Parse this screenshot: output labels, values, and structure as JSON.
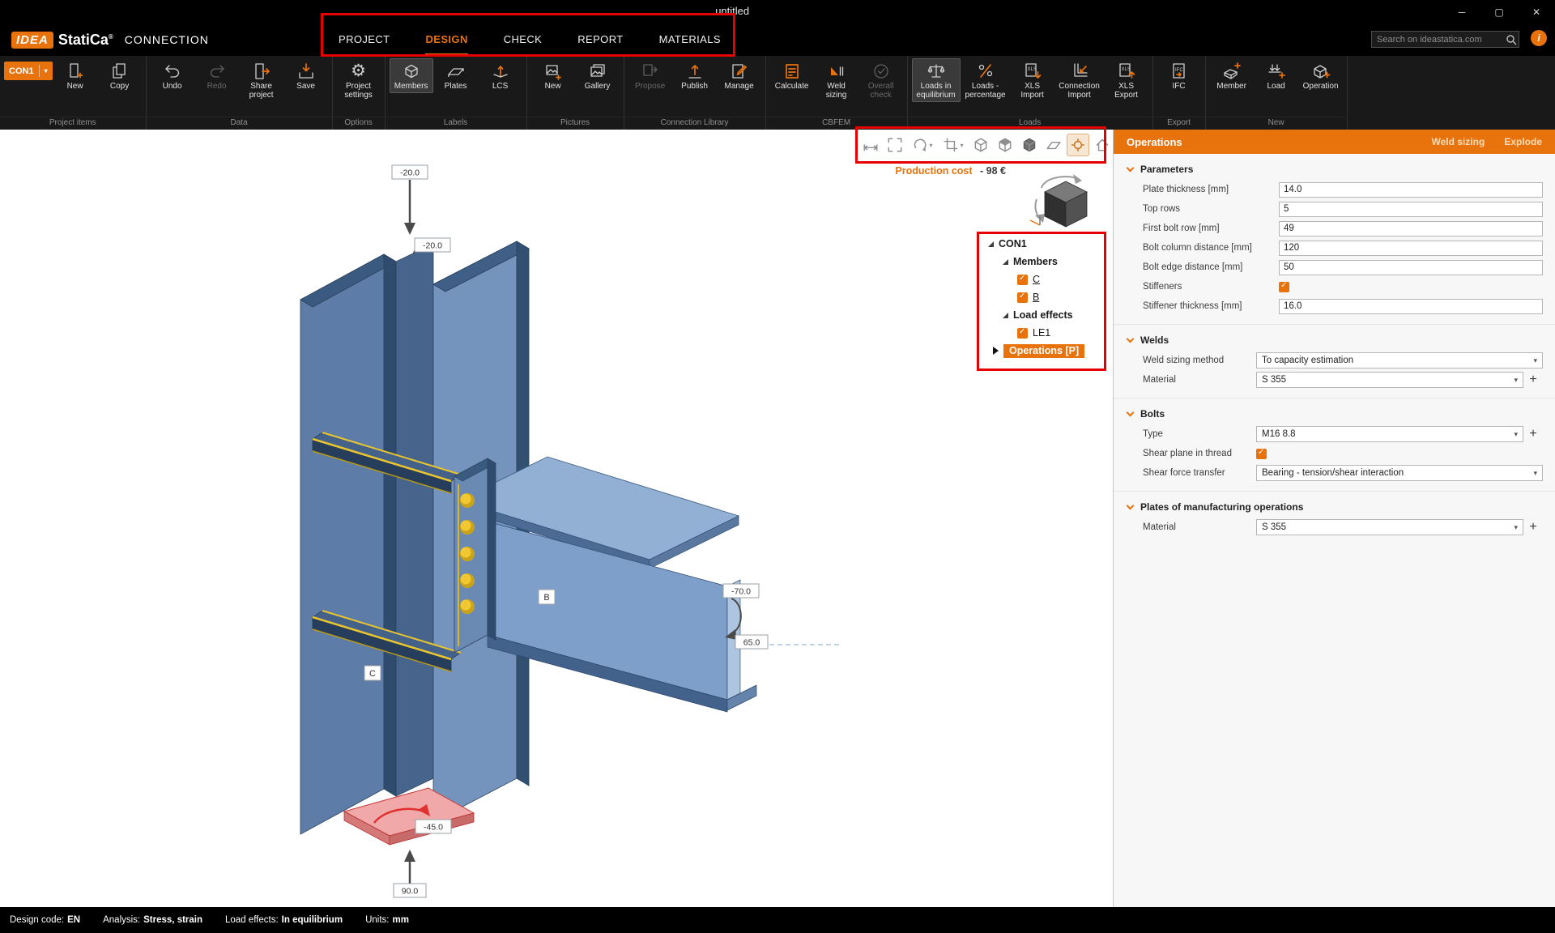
{
  "window": {
    "title": "untitled",
    "controls": {
      "minimize": "─",
      "maximize": "▢",
      "close": "✕"
    }
  },
  "header": {
    "logo": {
      "idea": "IDEA",
      "statica": "StatiCa",
      "reg": "®",
      "app": "CONNECTION"
    },
    "tabs": [
      {
        "label": "PROJECT"
      },
      {
        "label": "DESIGN"
      },
      {
        "label": "CHECK"
      },
      {
        "label": "REPORT"
      },
      {
        "label": "MATERIALS"
      }
    ],
    "active_tab": "DESIGN",
    "search_placeholder": "Search on ideastatica.com",
    "info": "i"
  },
  "ribbon": {
    "groups": [
      {
        "label": "Project items",
        "items": [
          {
            "label": "CON1"
          },
          {
            "label": "New"
          },
          {
            "label": "Copy"
          }
        ]
      },
      {
        "label": "Data",
        "items": [
          {
            "label": "Undo"
          },
          {
            "label": "Redo"
          },
          {
            "label": "Share project"
          },
          {
            "label": "Save"
          }
        ]
      },
      {
        "label": "Options",
        "items": [
          {
            "label": "Project settings"
          }
        ]
      },
      {
        "label": "Labels",
        "items": [
          {
            "label": "Members"
          },
          {
            "label": "Plates"
          },
          {
            "label": "LCS"
          }
        ]
      },
      {
        "label": "Pictures",
        "items": [
          {
            "label": "New"
          },
          {
            "label": "Gallery"
          }
        ]
      },
      {
        "label": "Connection Library",
        "items": [
          {
            "label": "Propose"
          },
          {
            "label": "Publish"
          },
          {
            "label": "Manage"
          }
        ]
      },
      {
        "label": "CBFEM",
        "items": [
          {
            "label": "Calculate"
          },
          {
            "label": "Weld sizing"
          },
          {
            "label": "Overall check"
          }
        ]
      },
      {
        "label": "Loads",
        "items": [
          {
            "label": "Loads in equilibrium"
          },
          {
            "label": "Loads - percentage"
          },
          {
            "label": "XLS Import"
          },
          {
            "label": "Connection Import"
          },
          {
            "label": "XLS Export"
          }
        ]
      },
      {
        "label": "Export",
        "items": [
          {
            "label": "IFC"
          }
        ]
      },
      {
        "label": "New",
        "items": [
          {
            "label": "Member"
          },
          {
            "label": "Load"
          },
          {
            "label": "Operation"
          }
        ]
      }
    ]
  },
  "viewport": {
    "production_cost_label": "Production cost",
    "production_cost_value": "-  98 €",
    "dims": {
      "top": "-20.0",
      "top_rot": "-20.0",
      "right_top": "-70.0",
      "right_rot": "65.0",
      "base": "-45.0",
      "bottom": "90.0"
    },
    "member_labels": {
      "beam": "B",
      "column": "C"
    }
  },
  "tree": {
    "root": "CON1",
    "members": "Members",
    "member_items": [
      {
        "label": "C"
      },
      {
        "label": "B"
      }
    ],
    "load_effects": "Load effects",
    "load_items": [
      {
        "label": "LE1"
      }
    ],
    "operations": "Operations [P]"
  },
  "panel": {
    "title": "Operations",
    "actions": [
      {
        "label": "Weld sizing"
      },
      {
        "label": "Explode"
      }
    ],
    "sections": [
      {
        "title": "Parameters",
        "rows": [
          {
            "label": "Plate thickness [mm]",
            "value": "14.0"
          },
          {
            "label": "Top rows",
            "value": "5"
          },
          {
            "label": "First bolt row [mm]",
            "value": "49"
          },
          {
            "label": "Bolt column distance [mm]",
            "value": "120"
          },
          {
            "label": "Bolt edge distance [mm]",
            "value": "50"
          },
          {
            "label": "Stiffeners",
            "checked": true
          },
          {
            "label": "Stiffener thickness [mm]",
            "value": "16.0"
          }
        ]
      },
      {
        "title": "Welds",
        "rows": [
          {
            "label": "Weld sizing method",
            "value": "To capacity estimation"
          },
          {
            "label": "Material",
            "value": "S 355"
          }
        ]
      },
      {
        "title": "Bolts",
        "rows": [
          {
            "label": "Type",
            "value": "M16 8.8"
          },
          {
            "label": "Shear plane in thread",
            "checked": true
          },
          {
            "label": "Shear force transfer",
            "value": "Bearing - tension/shear interaction"
          }
        ]
      },
      {
        "title": "Plates of manufacturing operations",
        "rows": [
          {
            "label": "Material",
            "value": "S 355"
          }
        ]
      }
    ]
  },
  "statusbar": {
    "items": [
      {
        "label": "Design code:",
        "value": "EN"
      },
      {
        "label": "Analysis:",
        "value": "Stress, strain"
      },
      {
        "label": "Load effects:",
        "value": "In equilibrium"
      },
      {
        "label": "Units:",
        "value": "mm"
      }
    ]
  },
  "colors": {
    "accent": "#e8720c",
    "annotation": "#e60000",
    "steel_light": "#8fadd2",
    "steel_mid": "#5d7da8",
    "bolt": "#f2c832",
    "base_plate": "#f0a8a8"
  }
}
